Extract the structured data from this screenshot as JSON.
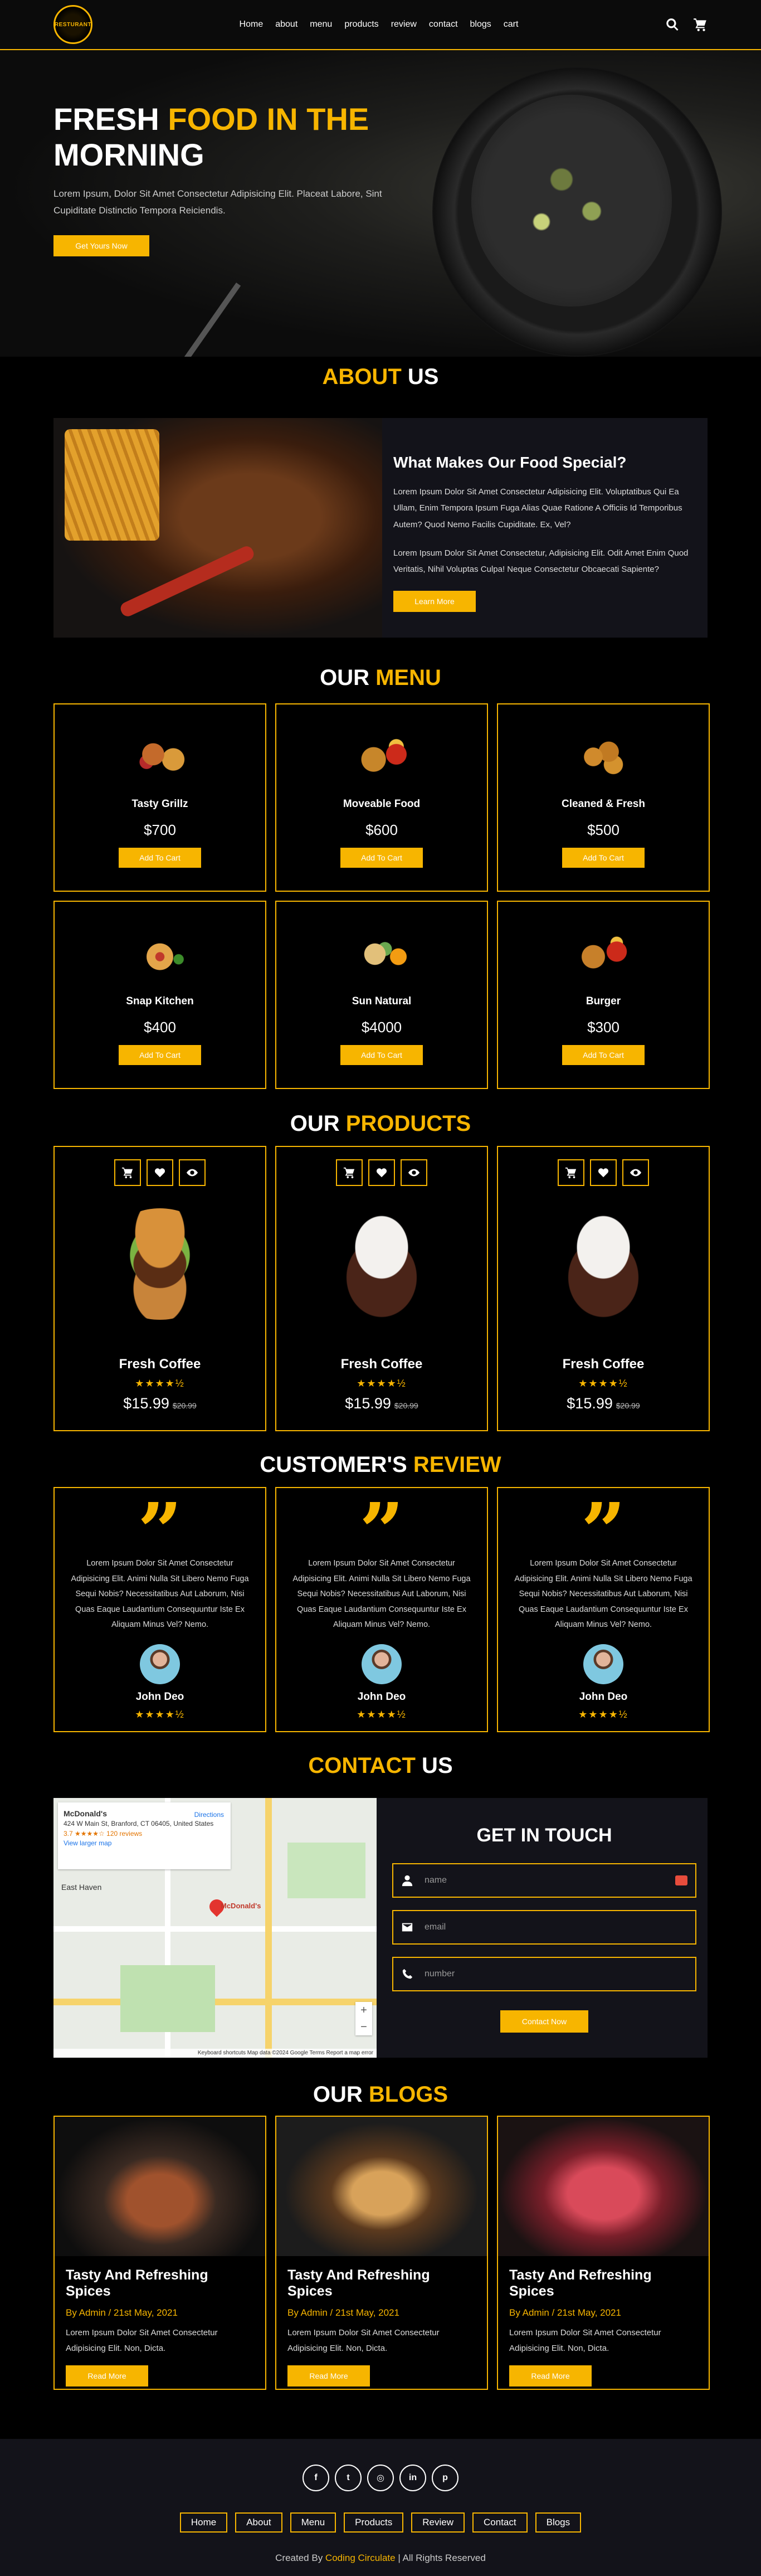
{
  "brand": {
    "logo_text": "RESTURANT",
    "accent": "#f7b500"
  },
  "nav": [
    "Home",
    "about",
    "menu",
    "products",
    "review",
    "contact",
    "blogs",
    "cart"
  ],
  "header_icons": [
    "search-icon",
    "cart-icon"
  ],
  "hero": {
    "title_white": "FRESH ",
    "title_yellow": "FOOD IN THE",
    "title_line2": "MORNING",
    "desc": "Lorem Ipsum, Dolor Sit Amet Consectetur Adipisicing Elit. Placeat Labore, Sint Cupiditate Distinctio Tempora Reiciendis.",
    "button": "Get Yours Now"
  },
  "about": {
    "title_yellow": "ABOUT",
    "title_white": " US",
    "heading": "What Makes Our Food Special?",
    "p1": "Lorem Ipsum Dolor Sit Amet Consectetur Adipisicing Elit. Voluptatibus Qui Ea Ullam, Enim Tempora Ipsum Fuga Alias Quae Ratione A Officiis Id Temporibus Autem? Quod Nemo Facilis Cupiditate. Ex, Vel?",
    "p2": "Lorem Ipsum Dolor Sit Amet Consectetur, Adipisicing Elit. Odit Amet Enim Quod Veritatis, Nihil Voluptas Culpa! Neque Consectetur Obcaecati Sapiente?",
    "button": "Learn More"
  },
  "menu": {
    "title_white": "OUR ",
    "title_yellow": "MENU",
    "items": [
      {
        "name": "Tasty Grillz",
        "price": "$700",
        "button": "Add To Cart"
      },
      {
        "name": "Moveable Food",
        "price": "$600",
        "button": "Add To Cart"
      },
      {
        "name": "Cleaned & Fresh",
        "price": "$500",
        "button": "Add To Cart"
      },
      {
        "name": "Snap Kitchen",
        "price": "$400",
        "button": "Add To Cart"
      },
      {
        "name": "Sun Natural",
        "price": "$4000",
        "button": "Add To Cart"
      },
      {
        "name": "Burger",
        "price": "$300",
        "button": "Add To Cart"
      }
    ]
  },
  "products": {
    "title_white": "OUR ",
    "title_yellow": "PRODUCTS",
    "items": [
      {
        "name": "Fresh Coffee",
        "stars": "★★★★½",
        "price": "$15.99",
        "old_price": "$20.99"
      },
      {
        "name": "Fresh Coffee",
        "stars": "★★★★½",
        "price": "$15.99",
        "old_price": "$20.99"
      },
      {
        "name": "Fresh Coffee",
        "stars": "★★★★½",
        "price": "$15.99",
        "old_price": "$20.99"
      }
    ]
  },
  "reviews": {
    "title_white": "CUSTOMER'S ",
    "title_yellow": "REVIEW",
    "items": [
      {
        "text": "Lorem Ipsum Dolor Sit Amet Consectetur Adipisicing Elit. Animi Nulla Sit Libero Nemo Fuga Sequi Nobis? Necessitatibus Aut Laborum, Nisi Quas Eaque Laudantium Consequuntur Iste Ex Aliquam Minus Vel? Nemo.",
        "name": "John Deo",
        "stars": "★★★★½"
      },
      {
        "text": "Lorem Ipsum Dolor Sit Amet Consectetur Adipisicing Elit. Animi Nulla Sit Libero Nemo Fuga Sequi Nobis? Necessitatibus Aut Laborum, Nisi Quas Eaque Laudantium Consequuntur Iste Ex Aliquam Minus Vel? Nemo.",
        "name": "John Deo",
        "stars": "★★★★½"
      },
      {
        "text": "Lorem Ipsum Dolor Sit Amet Consectetur Adipisicing Elit. Animi Nulla Sit Libero Nemo Fuga Sequi Nobis? Necessitatibus Aut Laborum, Nisi Quas Eaque Laudantium Consequuntur Iste Ex Aliquam Minus Vel? Nemo.",
        "name": "John Deo",
        "stars": "★★★★½"
      }
    ]
  },
  "contact": {
    "title_yellow": "CONTACT",
    "title_white": " US",
    "map": {
      "place": "McDonald's",
      "address": "424 W Main St, Branford, CT 06405, United States",
      "rating": "3.7 ★★★★☆  120 reviews",
      "larger_map": "View larger map",
      "directions": "Directions",
      "pin_label": "McDonald's",
      "town": "East Haven",
      "footer": "Keyboard shortcuts   Map data ©2024 Google   Terms   Report a map error"
    },
    "heading": "GET IN TOUCH",
    "fields": [
      {
        "placeholder": "name",
        "icon": "user-icon"
      },
      {
        "placeholder": "email",
        "icon": "envelope-icon"
      },
      {
        "placeholder": "number",
        "icon": "phone-icon"
      }
    ],
    "button": "Contact Now"
  },
  "blogs": {
    "title_white": "OUR ",
    "title_yellow": "BLOGS",
    "items": [
      {
        "title": "Tasty And Refreshing Spices",
        "meta": "By Admin / 21st May, 2021",
        "text": "Lorem Ipsum Dolor Sit Amet Consectetur Adipisicing Elit. Non, Dicta.",
        "button": "Read More"
      },
      {
        "title": "Tasty And Refreshing Spices",
        "meta": "By Admin / 21st May, 2021",
        "text": "Lorem Ipsum Dolor Sit Amet Consectetur Adipisicing Elit. Non, Dicta.",
        "button": "Read More"
      },
      {
        "title": "Tasty And Refreshing Spices",
        "meta": "By Admin / 21st May, 2021",
        "text": "Lorem Ipsum Dolor Sit Amet Consectetur Adipisicing Elit. Non, Dicta.",
        "button": "Read More"
      }
    ]
  },
  "footer": {
    "socials": [
      {
        "glyph": "f",
        "icon": "facebook-icon"
      },
      {
        "glyph": "t",
        "icon": "twitter-icon"
      },
      {
        "glyph": "◎",
        "icon": "instagram-icon"
      },
      {
        "glyph": "in",
        "icon": "linkedin-icon"
      },
      {
        "glyph": "p",
        "icon": "pinterest-icon"
      }
    ],
    "links": [
      "Home",
      "About",
      "Menu",
      "Products",
      "Review",
      "Contact",
      "Blogs"
    ],
    "credit_before": "Created By ",
    "credit_brand": "Coding Circulate",
    "credit_after": " | All Rights Reserved"
  }
}
